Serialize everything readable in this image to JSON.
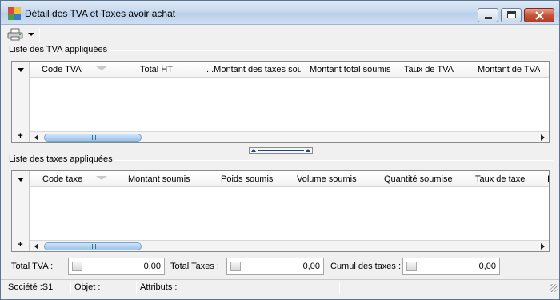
{
  "window": {
    "title": "Détail des TVA et Taxes avoir achat"
  },
  "toolbar": {
    "print_icon": "printer-icon",
    "dropdown_icon": "chevron-down-icon"
  },
  "tva_section": {
    "label": "Liste des TVA appliquées",
    "columns": [
      "Code TVA",
      "Total HT",
      "...Montant des taxes sou",
      "Montant total soumis",
      "Taux de TVA",
      "Montant de TVA"
    ],
    "add_label": "+"
  },
  "taxes_section": {
    "label": "Liste des taxes appliquées",
    "columns": [
      "Code taxe",
      "Montant soumis",
      "Poids soumis",
      "Volume soumis",
      "Quantité soumise",
      "Taux de taxe",
      "I"
    ],
    "add_label": "+"
  },
  "totals": {
    "total_tva_label": "Total TVA :",
    "total_tva_value": "0,00",
    "total_taxes_label": "Total Taxes :",
    "total_taxes_value": "0,00",
    "cumul_label": "Cumul des taxes :",
    "cumul_value": "0,00"
  },
  "statusbar": {
    "societe": "Société :S1",
    "objet": "Objet :",
    "attributs": "Attributs :"
  },
  "colors": {
    "titlebar": "#c8d9ee",
    "scroll_thumb": "#9cc4ea",
    "close_button": "#c7553c"
  }
}
